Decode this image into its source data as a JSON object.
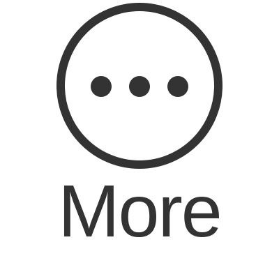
{
  "more_button": {
    "label": "More",
    "icon": "more-horizontal-circle-icon",
    "color": "#333333"
  }
}
